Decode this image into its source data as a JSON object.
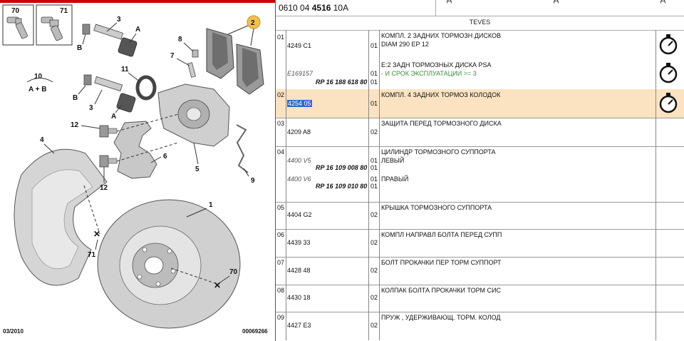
{
  "diagram": {
    "callouts": [
      "70",
      "71",
      "1",
      "2",
      "3",
      "4",
      "5",
      "6",
      "7",
      "8",
      "9",
      "10",
      "11",
      "12",
      "A",
      "B",
      "A + B"
    ],
    "footer_left": "03/2010",
    "footer_right": "00069266"
  },
  "header": {
    "ref_a": "0610 04 ",
    "ref_b": "4516",
    "ref_c": " 10A",
    "truncated": [
      "д",
      "д",
      "д"
    ]
  },
  "brand": "TEVES",
  "rows": [
    {
      "num": "01",
      "lines": [
        {
          "code": "4249 C1",
          "qty": "01",
          "desc": "КОМПЛ. 2 ЗАДНИХ ТОРМОЗН ДИСКОВ",
          "desc2": "DIAM 290 EP 12"
        },
        {
          "code_it": "E169157",
          "rp": "RP 16 188 618 80",
          "qty": "01",
          "desc": "E:2 ЗАДН ТОРМОЗНЫХ ДИСКА PSA",
          "desc2": "- И СРОК ЭКСПЛУАТАЦИИ >= 3"
        }
      ]
    },
    {
      "num": "02",
      "code": "4254 05",
      "qty": "01",
      "desc": "КОМПЛ. 4 ЗАДНИХ ТОРМОЗ КОЛОДОК"
    },
    {
      "num": "03",
      "code": "4209 A8",
      "qty": "02",
      "desc": "ЗАЩИТА ПЕРЕД ТОРМОЗНОГО ДИСКА"
    },
    {
      "num": "04",
      "desc": "ЦИЛИНДР ТОРМОЗНОГО СУППОРТА",
      "sub": [
        {
          "code_it": "4400 V5",
          "rp": "RP 16 109 008 80",
          "qty": "01",
          "qty2": "01",
          "desc": "ЛЕВЫЙ"
        },
        {
          "code_it": "4400 V6",
          "rp": "RP 16 109 010 80",
          "qty": "01",
          "qty2": "01",
          "desc": "ПРАВЫЙ"
        }
      ]
    },
    {
      "num": "05",
      "code": "4404 G2",
      "qty": "02",
      "desc": "КРЫШКА ТОРМОЗНОГО СУППОРТА"
    },
    {
      "num": "06",
      "code": "4439 33",
      "qty": "02",
      "desc": "КОМПЛ НАПРАВЛ БОЛТА ПЕРЕД СУПП"
    },
    {
      "num": "07",
      "code": "4428 48",
      "qty": "02",
      "desc": "БОЛТ ПРОКАЧКИ ПЕР ТОРМ СУППОРТ"
    },
    {
      "num": "08",
      "code": "4430 18",
      "qty": "02",
      "desc": "КОЛПАК БОЛТА ПРОКАЧКИ ТОРМ СИС"
    },
    {
      "num": "09",
      "code": "4427 E3",
      "qty": "02",
      "desc": "ПРУЖ , УДЕРЖИВАЮЩ. ТОРМ. КОЛОД"
    }
  ],
  "colors": {
    "highlight": "#fbe3c1",
    "selection": "#3366cc",
    "accent_red": "#cc0000",
    "callout_circle": "#f5c04a"
  },
  "icons": [
    "stopwatch-icon",
    "stopwatch-icon",
    "stopwatch-icon"
  ]
}
